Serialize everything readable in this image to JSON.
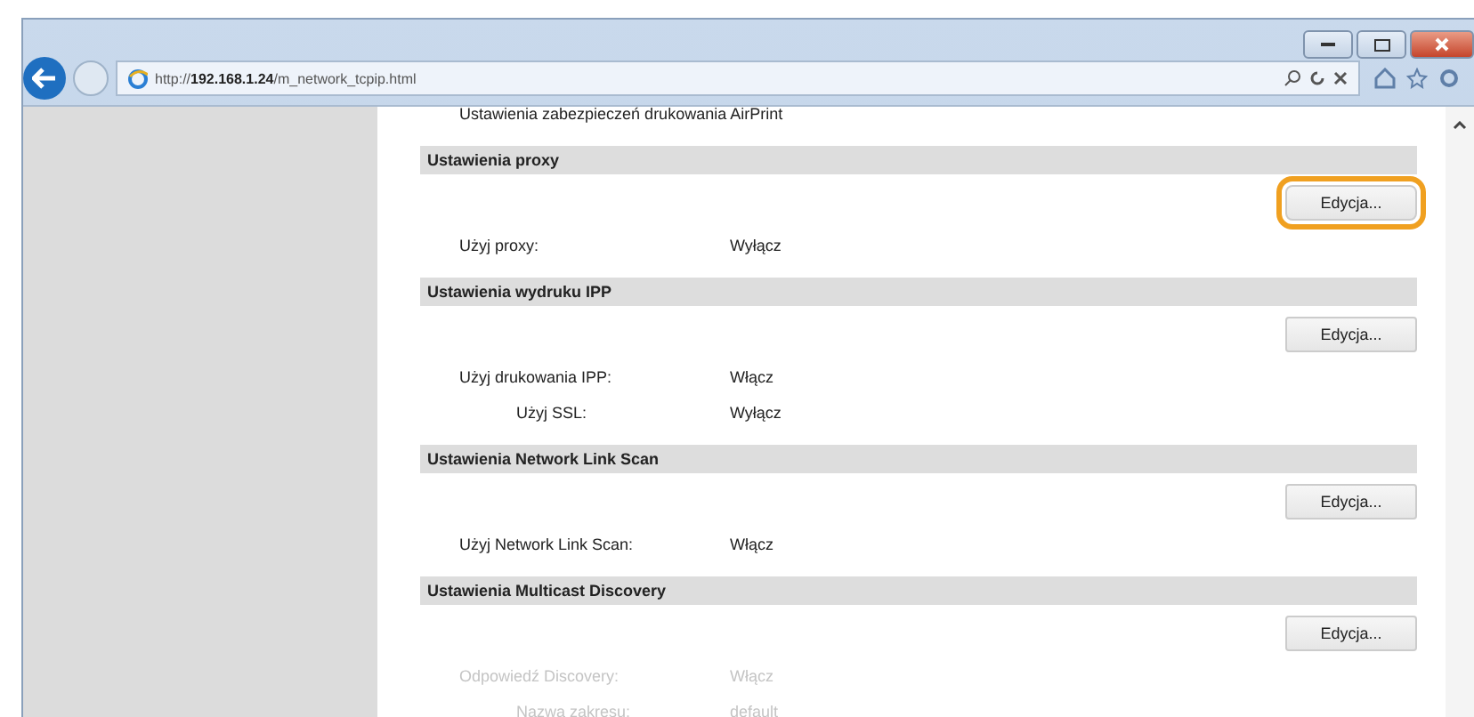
{
  "browser": {
    "url_prefix": "http://",
    "url_host": "192.168.1.24",
    "url_path": "/m_network_tcpip.html"
  },
  "top_text": "Ustawienia zabezpieczeń drukowania AirPrint",
  "sections": [
    {
      "title": "Ustawienia proxy",
      "button": {
        "label": "Edycja...",
        "highlighted": true
      },
      "rows": [
        {
          "label": "Użyj proxy:",
          "value": "Wyłącz",
          "faded": false
        }
      ]
    },
    {
      "title": "Ustawienia wydruku IPP",
      "button": {
        "label": "Edycja...",
        "highlighted": false
      },
      "rows": [
        {
          "label": "Użyj drukowania IPP:",
          "value": "Włącz",
          "faded": false,
          "children": [
            {
              "label": "Użyj SSL:",
              "value": "Wyłącz",
              "faded": false
            }
          ]
        }
      ]
    },
    {
      "title": "Ustawienia Network Link Scan",
      "button": {
        "label": "Edycja...",
        "highlighted": false
      },
      "rows": [
        {
          "label": "Użyj Network Link Scan:",
          "value": "Włącz",
          "faded": false
        }
      ]
    },
    {
      "title": "Ustawienia Multicast Discovery",
      "button": {
        "label": "Edycja...",
        "highlighted": false
      },
      "rows": [
        {
          "label": "Odpowiedź Discovery:",
          "value": "Włącz",
          "faded": true,
          "children": [
            {
              "label": "Nazwa zakresu:",
              "value": "default",
              "faded": true
            }
          ]
        }
      ]
    }
  ]
}
